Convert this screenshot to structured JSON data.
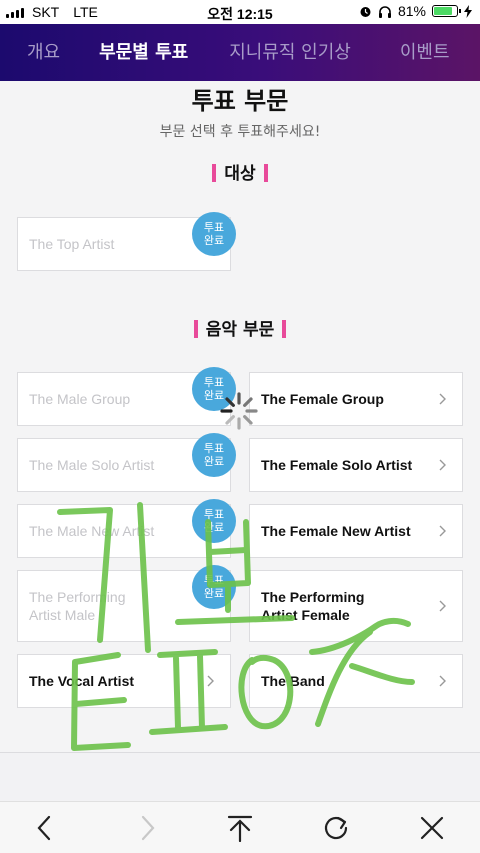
{
  "status_bar": {
    "carrier": "SKT",
    "network": "LTE",
    "time": "오전 12:15",
    "battery_percent": "81%",
    "battery_level": 0.81
  },
  "nav": {
    "tabs": [
      {
        "label": "개요"
      },
      {
        "label": "부문별 투표"
      },
      {
        "label": "지니뮤직 인기상"
      },
      {
        "label": "이벤트"
      }
    ],
    "active_index": 1
  },
  "main": {
    "title": "투표 부문",
    "subtitle": "부문 선택 후 투표해주세요!",
    "sections": [
      {
        "title": "대상",
        "items": [
          {
            "label": "The Top Artist",
            "status": "done",
            "badge": [
              "투표",
              "완료"
            ]
          }
        ]
      },
      {
        "title": "음악 부문",
        "items": [
          {
            "label": "The Male Group",
            "status": "done",
            "badge": [
              "투표",
              "완료"
            ]
          },
          {
            "label": "The Female Group",
            "status": "open"
          },
          {
            "label": "The Male Solo Artist",
            "status": "done",
            "badge": [
              "투표",
              "완료"
            ]
          },
          {
            "label": "The Female Solo Artist",
            "status": "open"
          },
          {
            "label": "The Male New Artist",
            "status": "done",
            "badge": [
              "투표",
              "완료"
            ]
          },
          {
            "label": "The Female New Artist",
            "status": "open"
          },
          {
            "label": [
              "The Performing",
              "Artist Male"
            ],
            "status": "done",
            "badge": [
              "투표",
              "완료"
            ]
          },
          {
            "label": [
              "The Performing",
              "Artist Female"
            ],
            "status": "open"
          },
          {
            "label": "The Vocal Artist",
            "status": "open"
          },
          {
            "label": "The Band",
            "status": "open"
          }
        ]
      }
    ]
  },
  "overlay": {
    "loading_spinner": true,
    "handwriting": "기부 트로이 ㅈ",
    "handwriting_color": "#6cc24a"
  },
  "toolbar": {
    "buttons": [
      "back-icon",
      "forward-icon",
      "share-icon",
      "reload-icon",
      "close-icon"
    ]
  },
  "colors": {
    "nav_gradient_start": "#1c0a6e",
    "nav_gradient_end": "#5b1466",
    "section_accent": "#e84a9a",
    "badge": "#49a8dc"
  }
}
